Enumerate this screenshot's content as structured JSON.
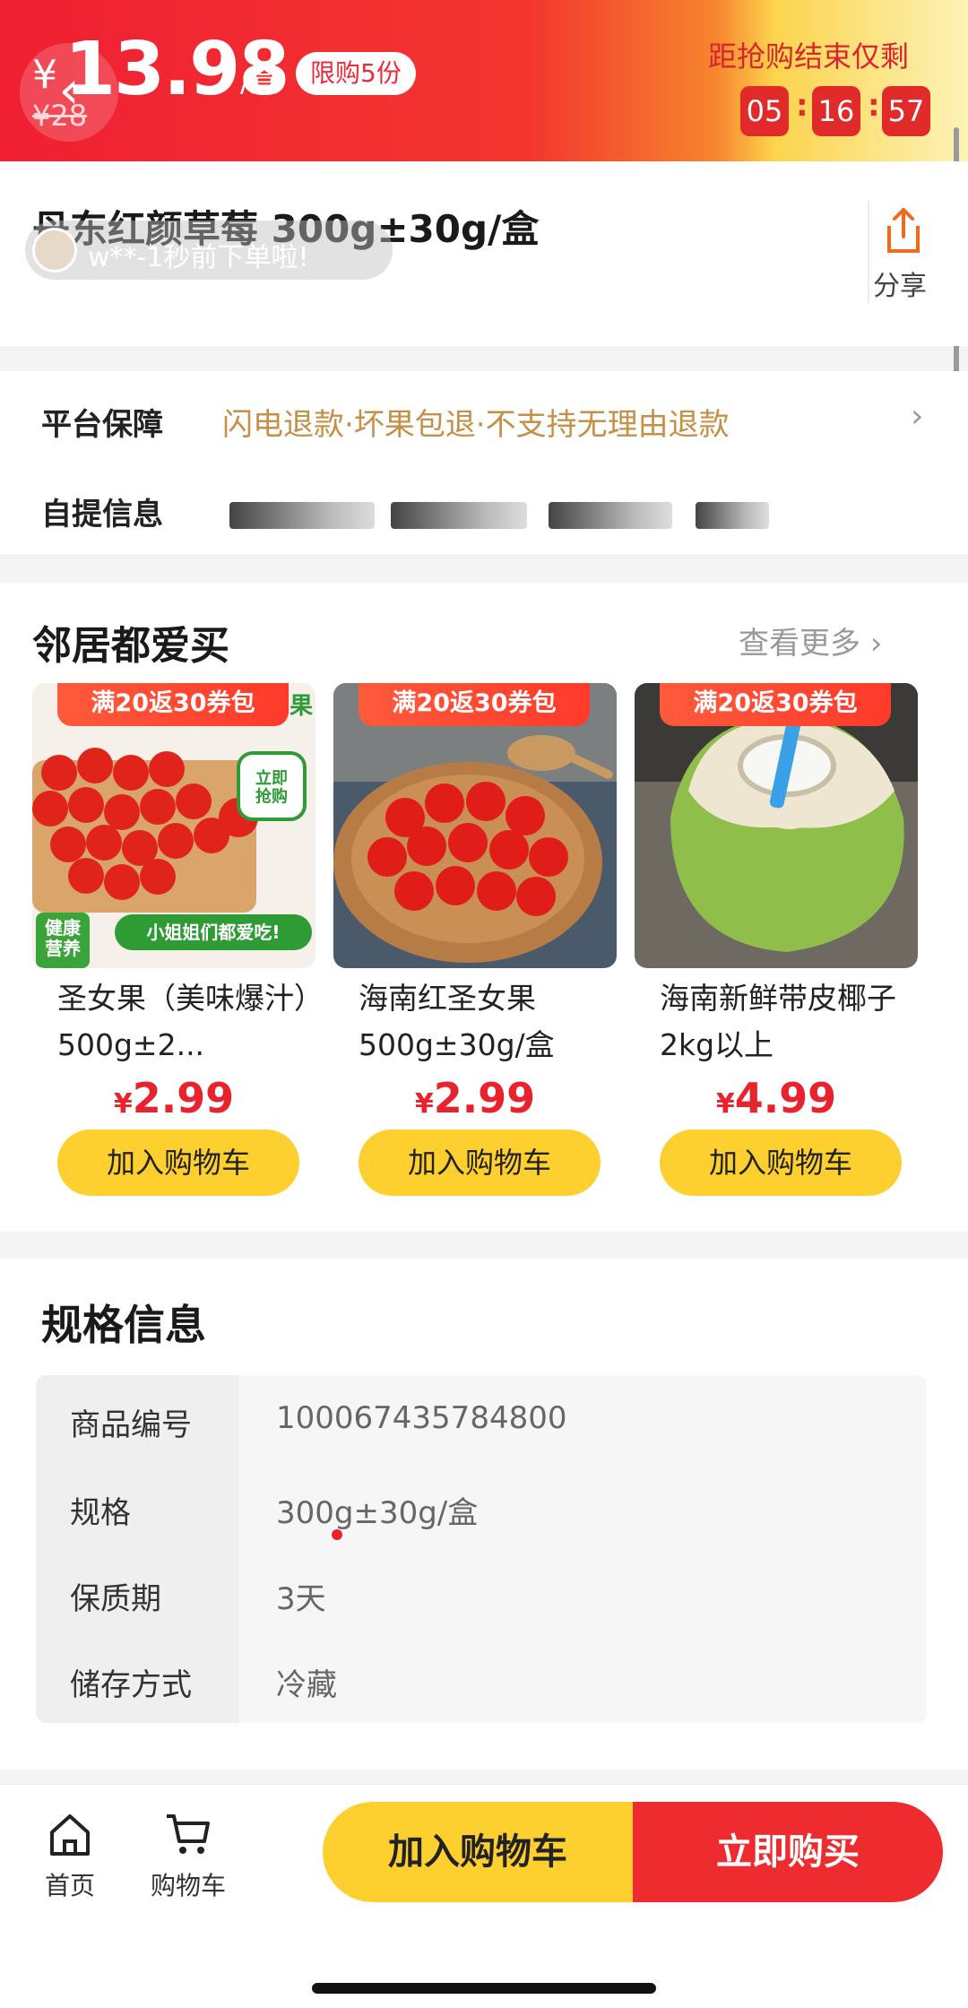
{
  "header": {
    "currency": "¥",
    "price": "13.98",
    "unit": "/盒",
    "limit_badge": "限购5份",
    "original_price": "¥28",
    "countdown_label": "距抢购结束仅剩",
    "countdown": {
      "hours": "05",
      "minutes": "16",
      "seconds": "57"
    },
    "colors": {
      "primary_red": "#f01f33",
      "gradient_end": "#fdf3b8"
    }
  },
  "product": {
    "title": "丹东红颜草莓 300g±30g/盒",
    "order_ticker": "w**-1秒前下单啦!",
    "share_label": "分享"
  },
  "guarantee": {
    "label": "平台保障",
    "text": "闪电退款·坏果包退·不支持无理由退款"
  },
  "pickup": {
    "label": "自提信息"
  },
  "neighbors": {
    "title": "邻居都爱买",
    "more": "查看更多",
    "items": [
      {
        "badge": "满20返30券包",
        "name": "圣女果（美味爆汁）500g±2...",
        "currency": "¥",
        "price": "2.99",
        "button": "加入购物车",
        "image": "cherry-tomatoes-on-board",
        "img_labels": {
          "top_right": "立即\n抢购",
          "bottom_left": "健康\n营养",
          "bottom_right": "小姐姐们都爱吃!",
          "corner": "果"
        }
      },
      {
        "badge": "满20返30券包",
        "name": "海南红圣女果 500g±30g/盒",
        "currency": "¥",
        "price": "2.99",
        "button": "加入购物车",
        "image": "cherry-tomatoes-in-bowl"
      },
      {
        "badge": "满20返30券包",
        "name": "海南新鲜带皮椰子 2kg以上",
        "currency": "¥",
        "price": "4.99",
        "button": "加入购物车",
        "image": "coconut-with-straw"
      }
    ]
  },
  "specs": {
    "title": "规格信息",
    "rows": [
      {
        "key": "商品编号",
        "value": "100067435784800"
      },
      {
        "key": "规格",
        "value": "300g±30g/盒"
      },
      {
        "key": "保质期",
        "value": "3天"
      },
      {
        "key": "储存方式",
        "value": "冷藏"
      }
    ]
  },
  "bottom_bar": {
    "home_label": "首页",
    "cart_label": "购物车",
    "add_to_cart": "加入购物车",
    "buy_now": "立即购买",
    "colors": {
      "yellow": "#fdcf2f",
      "red": "#ee2b2f"
    }
  }
}
